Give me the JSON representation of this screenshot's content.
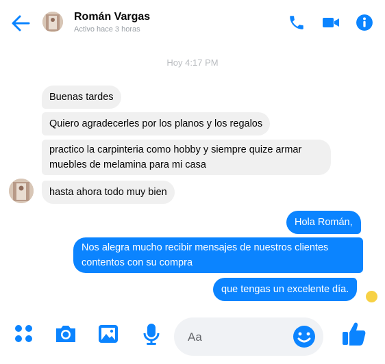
{
  "header": {
    "name": "Román Vargas",
    "status": "Activo hace 3 horas",
    "back_icon": "arrow-left-icon",
    "call_icon": "phone-icon",
    "video_icon": "video-camera-icon",
    "info_icon": "info-icon"
  },
  "timestamp": "Hoy 4:17 PM",
  "messages_in": [
    "Buenas tardes",
    "Quiero agradecerles por los planos y los regalos",
    "practico la carpinteria como hobby y siempre quize armar\nmuebles de melamina para mi casa",
    "hasta ahora todo muy bien"
  ],
  "messages_out": [
    "Hola Román,",
    "Nos alegra mucho recibir mensajes de nuestros clientes\ncontentos con su compra",
    "que tengas un excelente día."
  ],
  "composer": {
    "placeholder": "Aa",
    "icons": [
      "apps-icon",
      "camera-icon",
      "image-icon",
      "microphone-icon",
      "emoji-icon",
      "like-icon"
    ]
  },
  "colors": {
    "accent": "#0b84ff",
    "bubble_in": "#f0f0f0",
    "seen_dot": "#f7d145"
  }
}
